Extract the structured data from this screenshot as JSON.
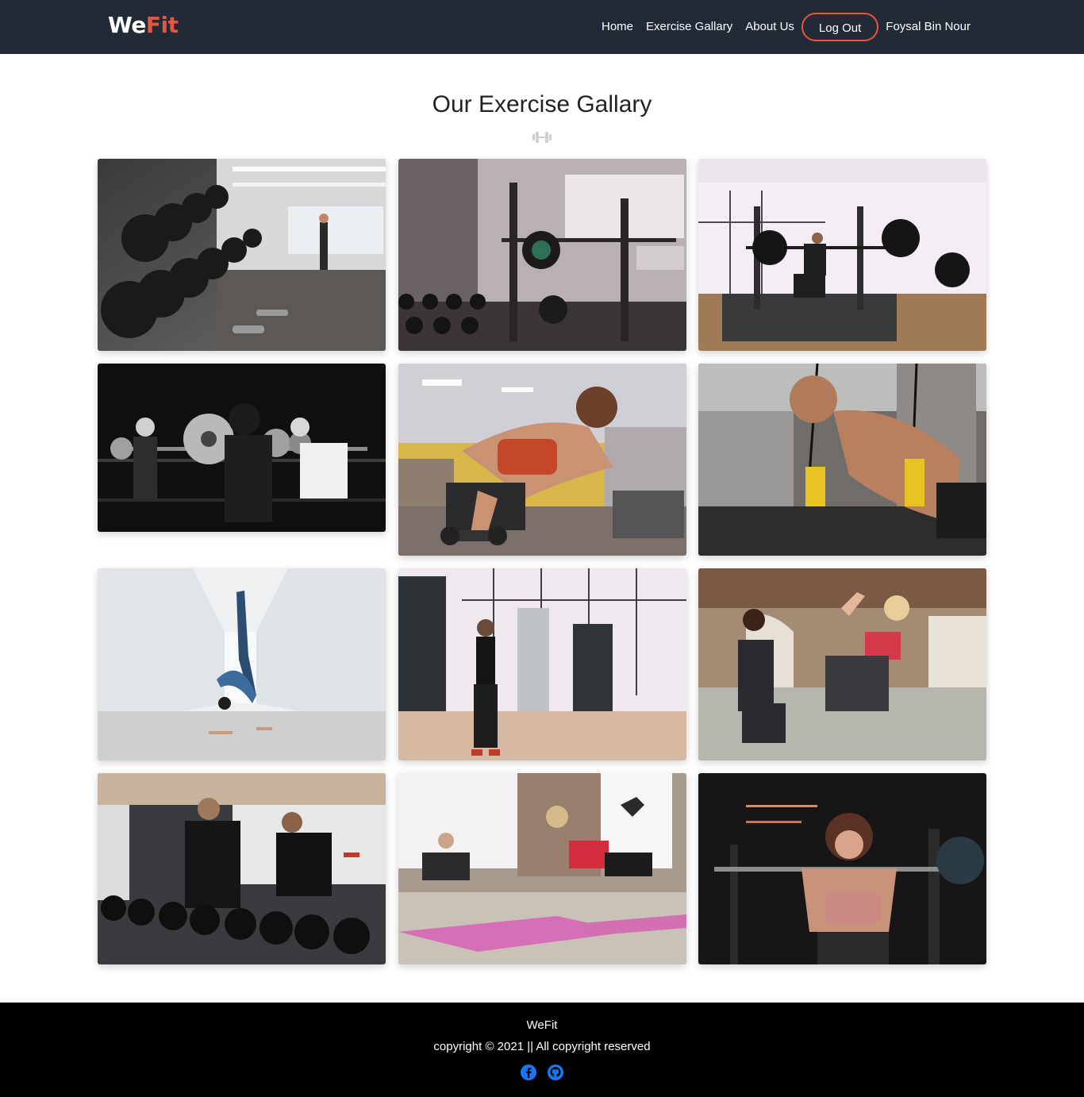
{
  "navbar": {
    "brand_we": "We",
    "brand_fit": "Fit",
    "links": {
      "home": "Home",
      "gallery": "Exercise Gallary",
      "about": "About Us",
      "logout": "Log Out",
      "user": "Foysal Bin Nour"
    },
    "colors": {
      "background": "#222a38",
      "accent": "#e8553f"
    }
  },
  "main": {
    "title": "Our Exercise Gallary",
    "divider_icon": "dumbbell-icon"
  },
  "gallery": {
    "images": [
      {
        "subject": "dumbbell-rack-gym-photo"
      },
      {
        "subject": "squat-rack-gym-photo"
      },
      {
        "subject": "man-squatting-photo"
      },
      {
        "subject": "group-barbell-squat-photo"
      },
      {
        "subject": "woman-dumbbell-row-photo"
      },
      {
        "subject": "man-trx-pushup-photo"
      },
      {
        "subject": "yoga-handstand-photo"
      },
      {
        "subject": "man-cable-machine-photo"
      },
      {
        "subject": "women-high-five-photo"
      },
      {
        "subject": "men-dumbbell-rack-photo"
      },
      {
        "subject": "women-mat-exercise-photo"
      },
      {
        "subject": "woman-barbell-squat-photo"
      }
    ]
  },
  "footer": {
    "brand": "WeFit",
    "copyright": "copyright © 2021 || All copyright reserved",
    "icons": [
      "facebook-icon",
      "github-icon"
    ],
    "icon_color": "#1877f2"
  }
}
